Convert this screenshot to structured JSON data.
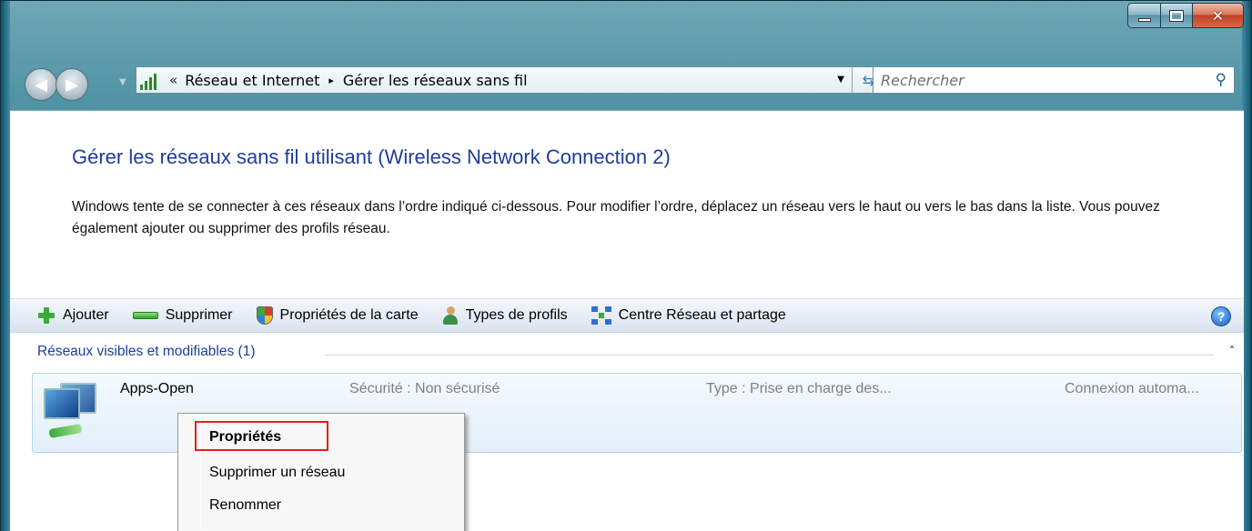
{
  "window": {
    "minimize_icon": "minimize-icon",
    "maximize_icon": "maximize-icon",
    "close_icon": "close-icon"
  },
  "nav": {
    "back_icon": "back-arrow-icon",
    "forward_icon": "forward-arrow-icon",
    "breadcrumb": {
      "prefix": "«",
      "items": [
        "Réseau et Internet",
        "Gérer les réseaux sans fil"
      ],
      "separator": "▸"
    },
    "search": {
      "placeholder": "Rechercher"
    }
  },
  "main": {
    "title": "Gérer les réseaux sans fil utilisant (Wireless Network Connection 2)",
    "description": "Windows tente de se connecter à ces réseaux dans l’ordre indiqué ci-dessous. Pour modifier l’ordre, déplacez un réseau vers le haut ou vers le bas dans la liste. Vous pouvez également ajouter ou supprimer des profils réseau."
  },
  "toolbar": {
    "items": [
      {
        "label": "Ajouter",
        "icon": "add-icon"
      },
      {
        "label": "Supprimer",
        "icon": "remove-icon"
      },
      {
        "label": "Propriétés de la carte",
        "icon": "shield-icon"
      },
      {
        "label": "Types de profils",
        "icon": "user-icon"
      },
      {
        "label": "Centre Réseau et partage",
        "icon": "network-icon"
      }
    ],
    "help": "?"
  },
  "group": {
    "header": "Réseaux visibles et modifiables (1)",
    "collapse": "˄"
  },
  "networks": [
    {
      "name": "Apps-Open",
      "security": "Sécurité : Non sécurisé",
      "type": "Type : Prise en charge des...",
      "connection": "Connexion automa..."
    }
  ],
  "context_menu": {
    "items": [
      "Propriétés",
      "Supprimer un réseau",
      "Renommer"
    ],
    "highlighted": "Propriétés",
    "highlight_color": "#e02020"
  }
}
